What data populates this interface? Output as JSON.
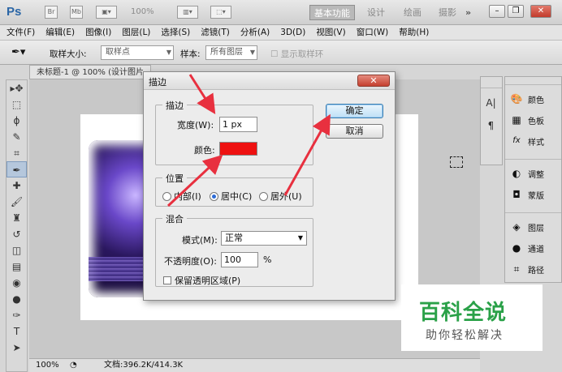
{
  "app": {
    "logo": "Ps",
    "zoom": "100%",
    "workspaces": [
      "基本功能",
      "设计",
      "绘画",
      "摄影"
    ],
    "more": "»"
  },
  "menu": [
    "文件(F)",
    "编辑(E)",
    "图像(I)",
    "图层(L)",
    "选择(S)",
    "滤镜(T)",
    "分析(A)",
    "3D(D)",
    "视图(V)",
    "窗口(W)",
    "帮助(H)"
  ],
  "options": {
    "sample_size_label": "取样大小:",
    "sample_size_value": "取样点",
    "sample_label": "样本:",
    "sample_value": "所有图层",
    "show_ring": "显示取样环"
  },
  "document": {
    "tab_title": "未标题-1 @ 100% (设计图片，RGB/8)",
    "status_zoom": "100%",
    "status_doc": "文档:396.2K/414.3K"
  },
  "panels": {
    "strip": [
      "A|",
      "¶"
    ],
    "groups": [
      [
        {
          "icon": "palette-icon",
          "glyph": "🎨",
          "label": "颜色"
        },
        {
          "icon": "swatches-icon",
          "glyph": "▦",
          "label": "色板"
        },
        {
          "icon": "styles-icon",
          "glyph": "fx",
          "label": "样式"
        }
      ],
      [
        {
          "icon": "adjust-icon",
          "glyph": "◐",
          "label": "调整"
        },
        {
          "icon": "mask-icon",
          "glyph": "◘",
          "label": "蒙版"
        }
      ],
      [
        {
          "icon": "layers-icon",
          "glyph": "◈",
          "label": "图层"
        },
        {
          "icon": "channels-icon",
          "glyph": "●",
          "label": "通道"
        },
        {
          "icon": "paths-icon",
          "glyph": "⌗",
          "label": "路径"
        }
      ]
    ]
  },
  "dialog": {
    "title": "描边",
    "stroke_group": "描边",
    "width_label": "宽度(W):",
    "width_value": "1 px",
    "color_label": "颜色:",
    "color_value": "#ee1111",
    "position_group": "位置",
    "position_options": [
      "内部(I)",
      "居中(C)",
      "居外(U)"
    ],
    "position_selected": 1,
    "blend_group": "混合",
    "mode_label": "模式(M):",
    "mode_value": "正常",
    "opacity_label": "不透明度(O):",
    "opacity_value": "100",
    "opacity_unit": "%",
    "preserve_label": "保留透明区域(P)",
    "ok_label": "确定",
    "cancel_label": "取消"
  },
  "watermark": {
    "main": "百科全说",
    "sub": "助你轻松解决"
  },
  "colors": {
    "annotation_arrow": "#e8303f",
    "stroke_color": "#ee1111",
    "watermark_green": "#2aa148"
  }
}
